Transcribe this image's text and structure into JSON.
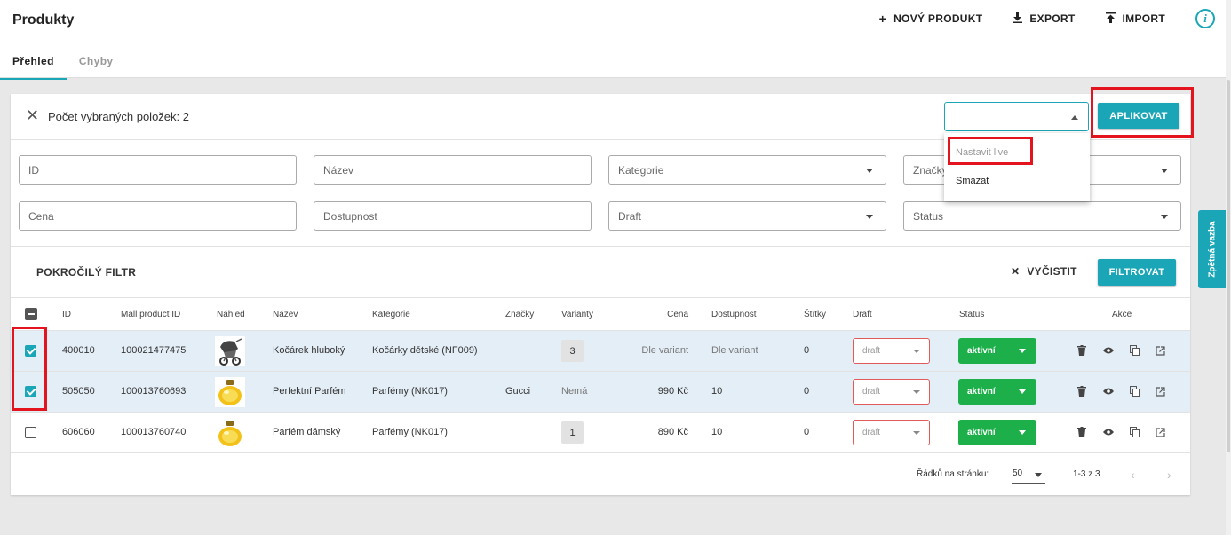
{
  "header": {
    "title": "Produkty",
    "actions": {
      "new_product": "NOVÝ PRODUKT",
      "export": "EXPORT",
      "import": "IMPORT"
    },
    "info_icon_text": "i"
  },
  "tabs": [
    {
      "label": "Přehled",
      "active": true
    },
    {
      "label": "Chyby",
      "active": false
    }
  ],
  "selection": {
    "count_text": "Počet vybraných položek: 2",
    "action_value": "",
    "apply_label": "APLIKOVAT",
    "dropdown_options": [
      "Nastavit live",
      "Smazat"
    ]
  },
  "filters": {
    "id": "ID",
    "name": "Název",
    "category": "Kategorie",
    "brands": "Značky",
    "price": "Cena",
    "availability": "Dostupnost",
    "draft": "Draft",
    "status": "Status"
  },
  "advanced": {
    "advanced_filter": "POKROČILÝ FILTR",
    "clear": "VYČISTIT",
    "filter": "FILTROVAT"
  },
  "table": {
    "columns": {
      "id": "ID",
      "mall_id": "Mall product ID",
      "preview": "Náhled",
      "name": "Název",
      "category": "Kategorie",
      "brands": "Značky",
      "variants": "Varianty",
      "price": "Cena",
      "availability": "Dostupnost",
      "labels": "Štítky",
      "draft": "Draft",
      "status": "Status",
      "actions": "Akce"
    },
    "rows": [
      {
        "checked": true,
        "id": "400010",
        "mall_id": "100021477475",
        "preview": "stroller",
        "name": "Kočárek hluboký",
        "category": "Kočárky dětské  (NF009)",
        "brand": "",
        "variants": "3",
        "price": "Dle variant",
        "availability": "Dle variant",
        "labels": "0",
        "draft": "draft",
        "status": "aktivní"
      },
      {
        "checked": true,
        "id": "505050",
        "mall_id": "100013760693",
        "preview": "perfume",
        "name": "Perfektní Parfém",
        "category": "Parfémy  (NK017)",
        "brand": "Gucci",
        "variants": "Nemá",
        "price": "990 Kč",
        "availability": "10",
        "labels": "0",
        "draft": "draft",
        "status": "aktivní"
      },
      {
        "checked": false,
        "id": "606060",
        "mall_id": "100013760740",
        "preview": "perfume",
        "name": "Parfém dámský",
        "category": "Parfémy  (NK017)",
        "brand": "",
        "variants": "1",
        "price": "890 Kč",
        "availability": "10",
        "labels": "0",
        "draft": "draft",
        "status": "aktivní"
      }
    ]
  },
  "pagination": {
    "rows_per_page_label": "Řádků na stránku:",
    "rows_per_page": "50",
    "range": "1-3 z 3",
    "prev": "‹",
    "next": "›"
  },
  "feedback_tab": "Zpětná vazba",
  "colors": {
    "accent": "#1aa6b7",
    "status_active": "#1db04a",
    "highlight": "#e3141e",
    "selected_row": "#e4eef7"
  }
}
